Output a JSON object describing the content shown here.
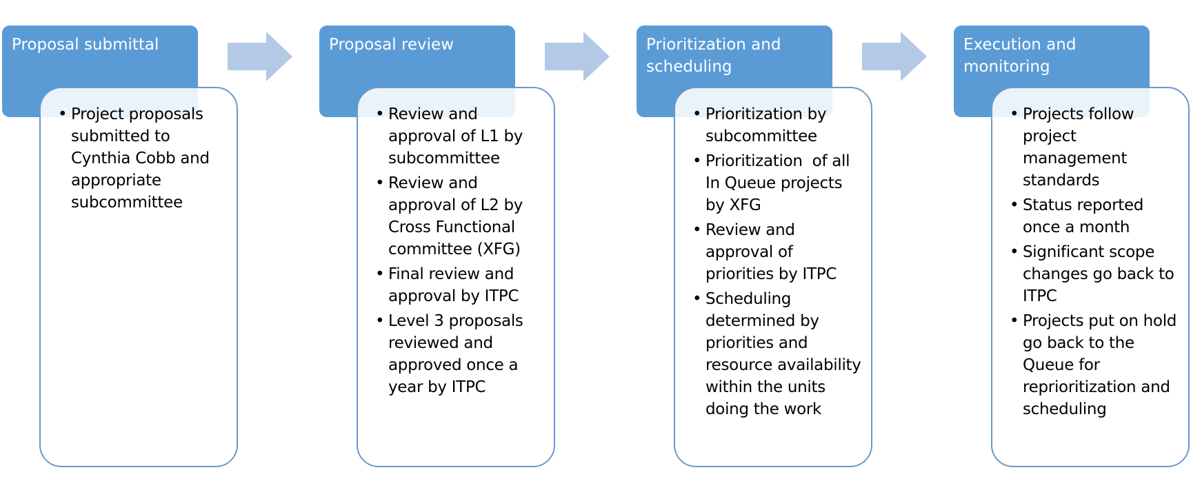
{
  "colors": {
    "header_fill": "#5b9bd5",
    "detail_border": "#6a99c9",
    "arrow_fill": "#b4c9e6"
  },
  "stages": [
    {
      "title": "Proposal submittal",
      "items": [
        "Project proposals submitted to Cynthia Cobb and appropriate subcommittee"
      ]
    },
    {
      "title": "Proposal review",
      "items": [
        "Review and approval of L1 by subcommittee",
        "Review and approval of L2 by Cross Functional committee (XFG)",
        "Final review and approval by ITPC",
        "Level 3 proposals reviewed and approved once a year by ITPC"
      ]
    },
    {
      "title": "Prioritization and scheduling",
      "items": [
        "Prioritization by subcommittee",
        "Prioritization  of all In Queue projects by XFG",
        "Review and approval of priorities by ITPC",
        "Scheduling determined by priorities and resource availability within the units doing the work"
      ]
    },
    {
      "title": "Execution and monitoring",
      "items": [
        "Projects follow project management standards",
        "Status reported once a month",
        "Significant scope changes go back to ITPC",
        "Projects put on hold go back to the Queue for reprioritization and scheduling"
      ]
    }
  ],
  "bullet_glyph": "•"
}
